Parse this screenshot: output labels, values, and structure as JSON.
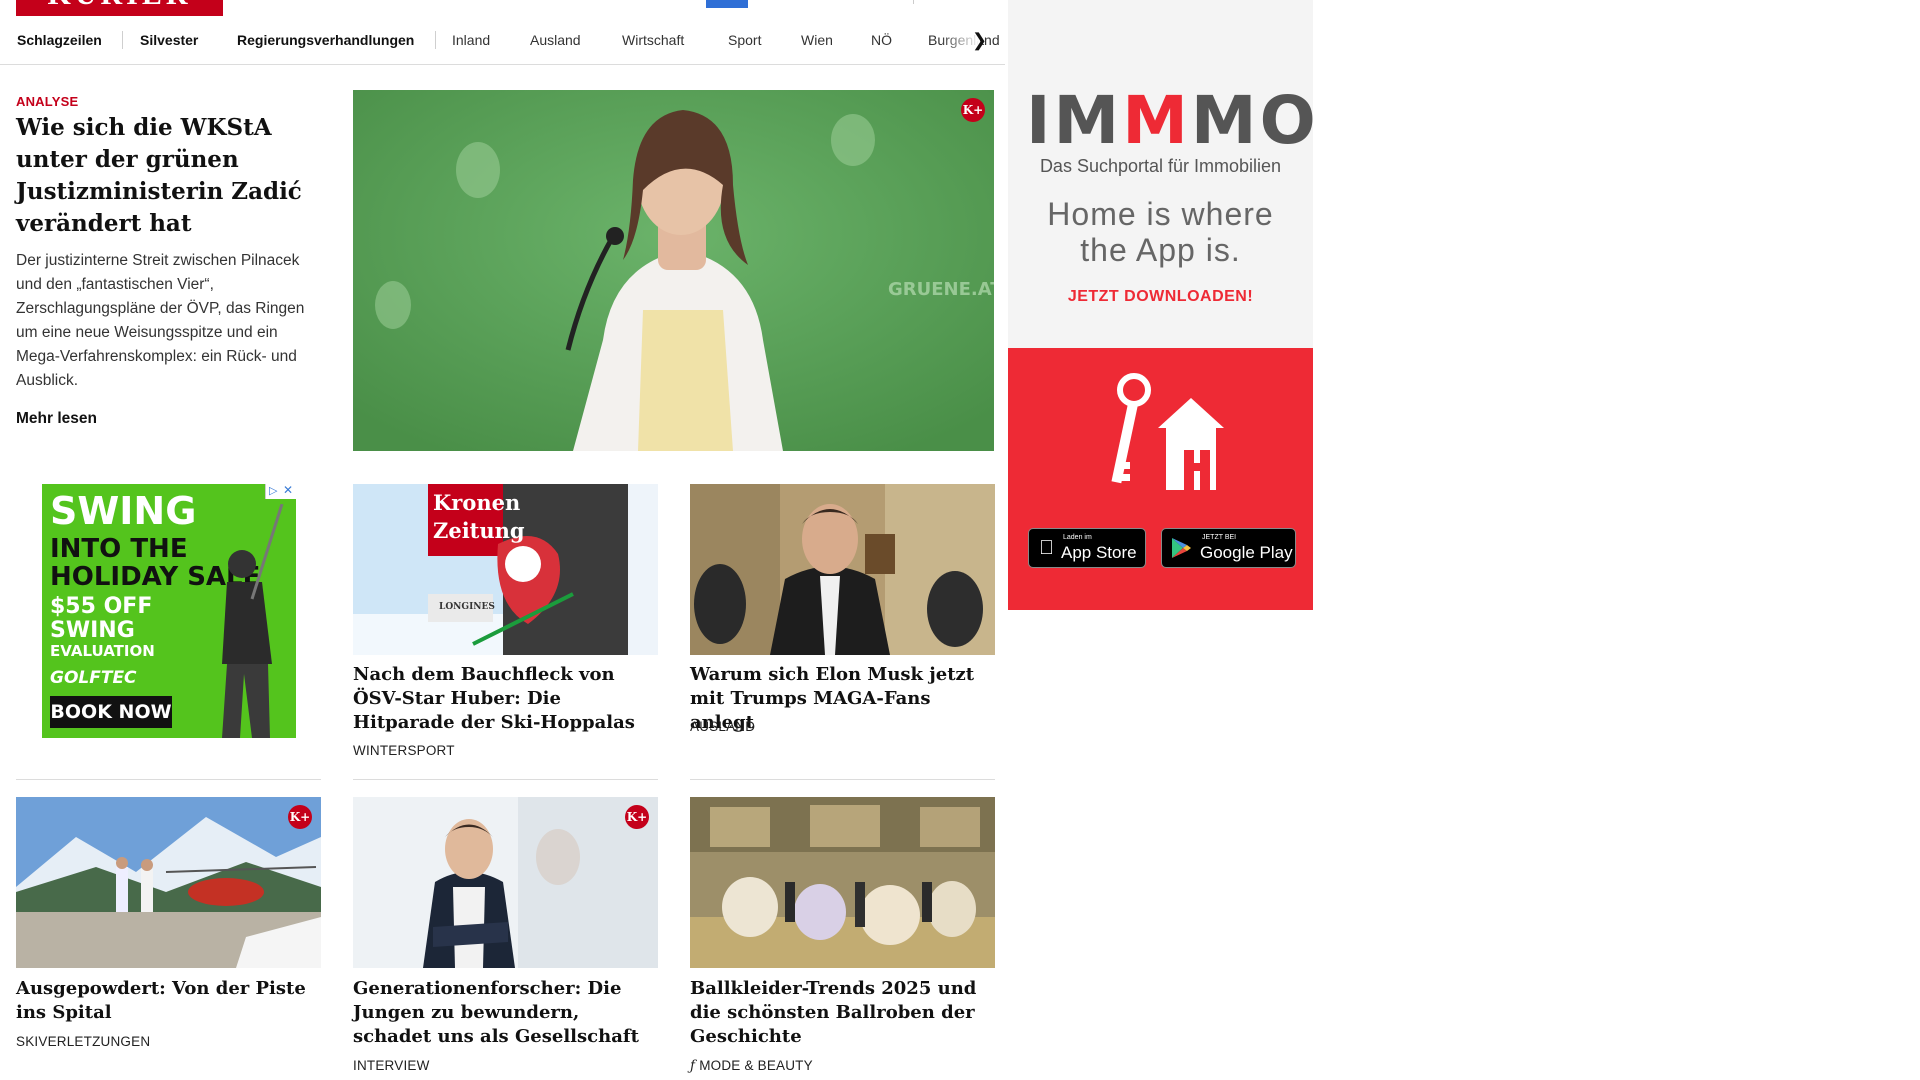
{
  "header": {
    "logo": "KURIER",
    "nav": [
      {
        "label": "Schlagzeilen",
        "bold": true
      },
      {
        "label": "Silvester",
        "bold": true
      },
      {
        "label": "Regierungsverhandlungen",
        "bold": true
      },
      {
        "label": "Inland",
        "bold": false
      },
      {
        "label": "Ausland",
        "bold": false
      },
      {
        "label": "Wirtschaft",
        "bold": false
      },
      {
        "label": "Sport",
        "bold": false
      },
      {
        "label": "Wien",
        "bold": false
      },
      {
        "label": "NÖ",
        "bold": false
      },
      {
        "label": "Burgenland",
        "bold": false
      }
    ]
  },
  "hero": {
    "kicker": "ANALYSE",
    "title": "Wie sich die WKStA un­ter der grünen Justizmi­nisterin Zadić verändert hat",
    "teaser": "Der justizinterne Streit zwischen Pilnacek und den „fantastischen Vier“, Zerschlagungspläne der ÖVP, das Ringen um eine neue Weisungsspitze und ein Mega-Verfahrenskomplex: ein Rück- und Ausblick.",
    "more": "Mehr lesen",
    "badge": "K+",
    "backdrop_text": "GRUENE.AT"
  },
  "cards": [
    {
      "title": "Nach dem Bauchfleck von ÖSV-Star Huber: Die Hitparade der Ski-Hoppalas",
      "category": "WINTERSPORT",
      "banner_lines": [
        "Kronen",
        "Zeitung"
      ],
      "banner_sub": "LONGINES"
    },
    {
      "title": "Warum sich Elon Musk jetzt mit Trumps MAGA-Fans anlegt",
      "category": "AUSLAND"
    },
    {
      "title": "Ausgepowdert: Von der Piste ins Spital",
      "category": "SKIVERLETZUNGEN",
      "badge": "K+"
    },
    {
      "title": "Generationenforscher: Die Jungen zu bewundern, schadet uns als Gesellschaft",
      "category": "INTERVIEW",
      "badge": "K+"
    },
    {
      "title": "Ballkleider-Trends 2025 und die schönsten Ballroben der Geschichte",
      "category": "MODE & BEAUTY"
    }
  ],
  "ad_swing": {
    "line1": "SWING",
    "line2": "INTO THE",
    "line3": "HOLIDAY SALE",
    "line4": "$55 OFF",
    "line5": "SWING",
    "line6": "EVALUATION",
    "brand": "GOLFTEC",
    "cta": "BOOK NOW"
  },
  "ad_immmo": {
    "logo_a": "IM",
    "logo_m": "M",
    "logo_b": "MO",
    "subtitle": "Das Suchportal für Immobilien",
    "headline_1": "Home is where",
    "headline_2": "the App is.",
    "cta": "JETZT DOWNLOADEN!",
    "appstore_small": "Laden im",
    "appstore_big": "App Store",
    "play_small": "JETZT BEI",
    "play_big": "Google Play"
  },
  "colors": {
    "brand_red": "#c4001a",
    "ad_red": "#ee2a35",
    "ad_green": "#54c41d"
  }
}
